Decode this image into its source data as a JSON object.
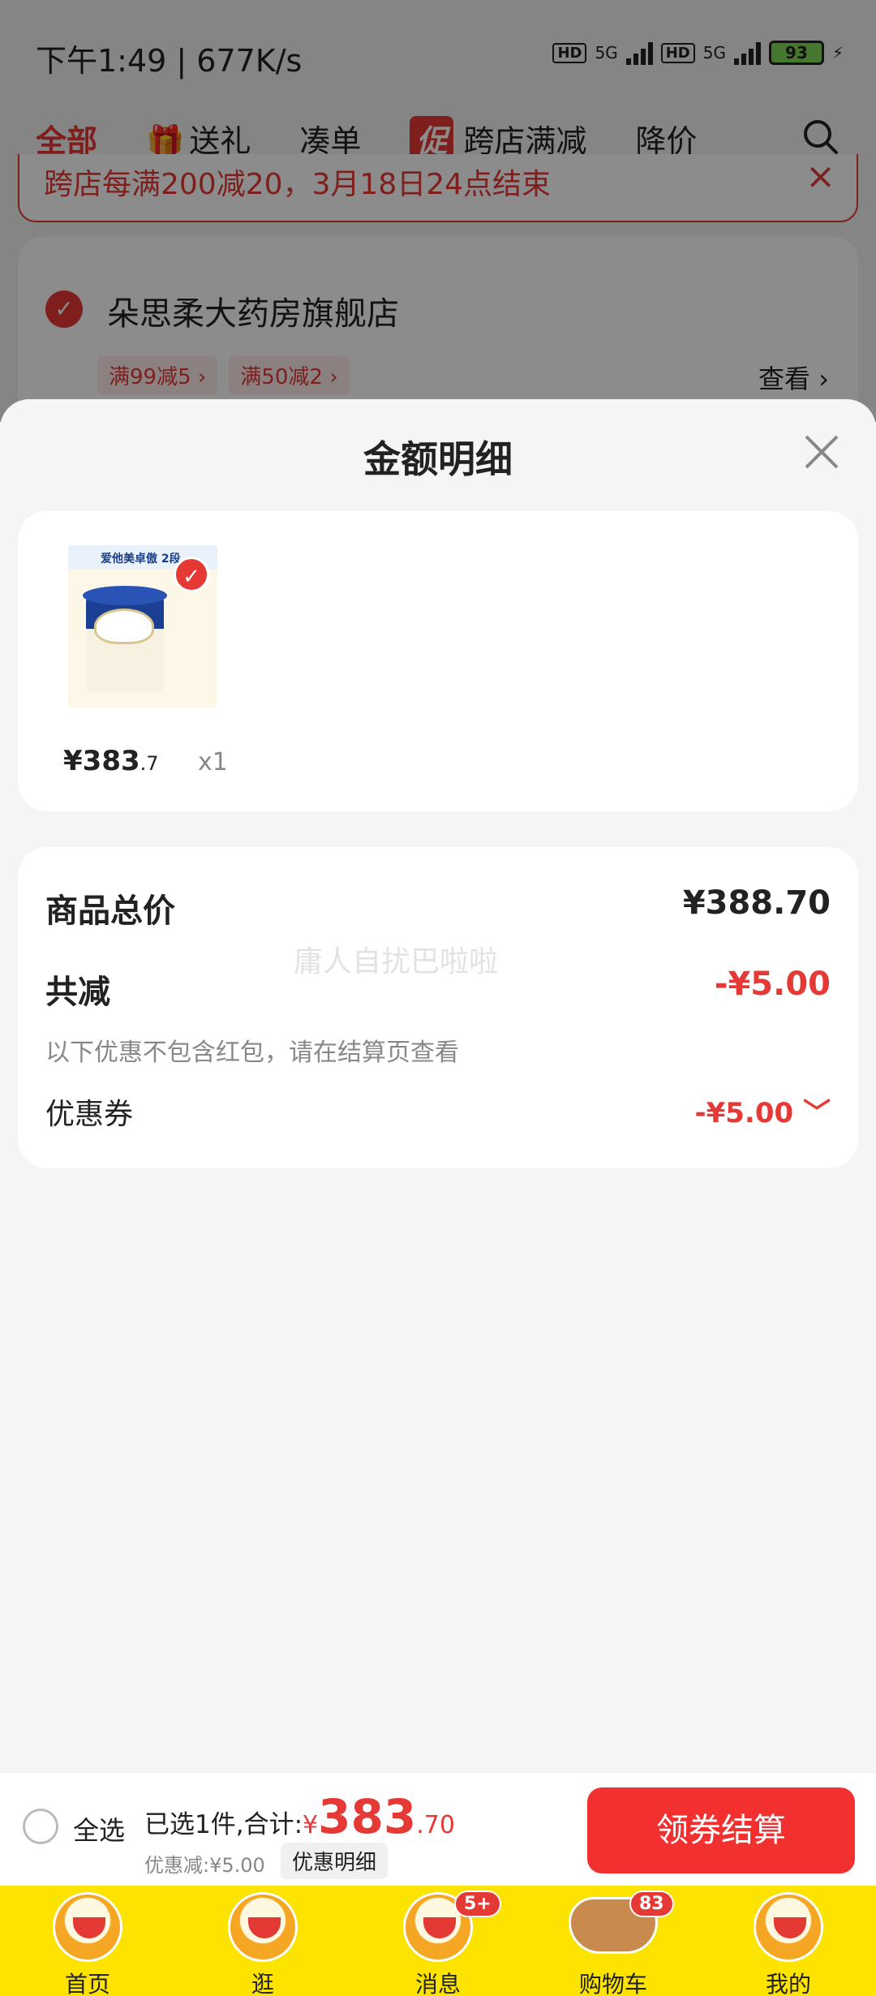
{
  "status_bar": {
    "time_speed": "下午1:49 | 677K/s",
    "net_1": "HD",
    "net_1_gen": "5G",
    "net_2": "HD",
    "net_2_gen": "5G",
    "battery": "93"
  },
  "tabs": [
    {
      "label": "全部"
    },
    {
      "label": "送礼"
    },
    {
      "label": "凑单"
    },
    {
      "tag": "促",
      "label": "跨店满减"
    },
    {
      "label": "降价"
    }
  ],
  "promo_banner": {
    "text": "跨店每满200减20，3月18日24点结束",
    "close": "×"
  },
  "store": {
    "check": "✓",
    "name": "朵思柔大药房旗舰店",
    "tags": [
      "满99减5 ›",
      "满50减2 ›"
    ],
    "more": "查看 ›"
  },
  "sheet": {
    "title": "金额明细",
    "item": {
      "img_caption": "爱他美卓傲 2段",
      "check": "✓",
      "price_int": "¥383",
      "price_dec": ".7",
      "qty": "x1"
    },
    "summary": {
      "total_label": "商品总价",
      "total_value": "¥388.70",
      "reduce_label": "共减",
      "reduce_value": "-¥5.00",
      "note": "以下优惠不包含红包，请在结算页查看",
      "coupon_label": "优惠券",
      "coupon_value": "-¥5.00 ﹀",
      "watermark": "庸人自扰巴啦啦"
    }
  },
  "checkout": {
    "select_all": "全选",
    "selected_text": "已选1件,合计:",
    "currency": "¥",
    "total_int": "383",
    "total_dec": ".70",
    "discount": "优惠减:¥5.00",
    "detail_button": "优惠明细",
    "pay_button": "领券结算"
  },
  "tabbar": [
    {
      "label": "首页"
    },
    {
      "label": "逛"
    },
    {
      "label": "消息",
      "badge": "5+"
    },
    {
      "label": "购物车",
      "badge": "83"
    },
    {
      "label": "我的"
    }
  ],
  "colors": {
    "accent": "#e53935",
    "tabbar_bg": "#fce300",
    "pay_button": "#f23030"
  }
}
